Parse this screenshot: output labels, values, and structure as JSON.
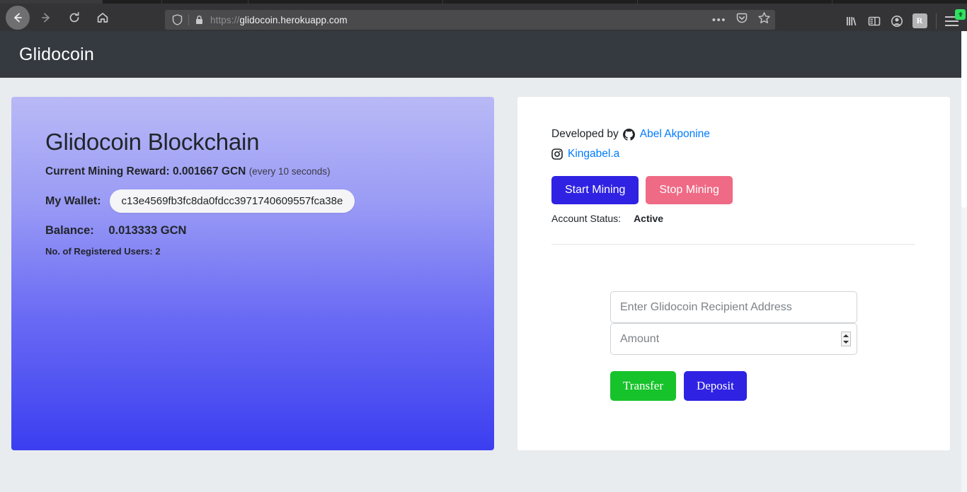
{
  "browser": {
    "url_scheme": "https://",
    "url_host": "glidocoin.herokuapp.com",
    "back_icon": "back-arrow-icon",
    "forward_icon": "forward-arrow-icon",
    "reload_icon": "reload-icon",
    "home_icon": "home-icon",
    "shield_icon": "shield-icon",
    "lock_icon": "lock-icon",
    "page_actions_icon": "ellipsis-icon",
    "pocket_icon": "pocket-icon",
    "bookmark_icon": "star-icon",
    "library_icon": "library-icon",
    "sidebar_icon": "sidebar-icon",
    "account_icon": "account-icon",
    "extension_badge_label": "R",
    "menu_icon": "hamburger-menu-icon",
    "update_badge_icon": "update-available-icon"
  },
  "site": {
    "brand": "Glidocoin",
    "navbar_color": "#343a40",
    "page_background": "#e9ecef"
  },
  "hero": {
    "title": "Glidocoin Blockchain",
    "reward_label": "Current Mining Reward: 0.001667 GCN",
    "reward_interval": "(every 10 seconds)",
    "wallet_label": "My Wallet:",
    "wallet_address": "c13e4569fb3fc8da0fdcc3971740609557fca38e",
    "balance_label": "Balance:",
    "balance_value": "0.013333 GCN",
    "registered_users": "No. of Registered Users: 2",
    "gradient_from": "#b9b9f6",
    "gradient_to": "#3b3ef0"
  },
  "panel": {
    "developed_by_text": "Developed by",
    "developer_name": "Abel Akponine",
    "github_icon": "github-icon",
    "instagram_icon": "instagram-icon",
    "instagram_handle": "Kingabel.a",
    "link_color": "#007bff",
    "start_mining_label": "Start Mining",
    "stop_mining_label": "Stop Mining",
    "start_mining_color": "#2f22e3",
    "stop_mining_color": "#ef6a85",
    "account_status_label": "Account Status:",
    "account_status_value": "Active",
    "recipient_placeholder": "Enter Glidocoin Recipient Address",
    "recipient_value": "",
    "amount_placeholder": "Amount",
    "amount_value": "",
    "transfer_label": "Transfer",
    "deposit_label": "Deposit",
    "transfer_color": "#16c32a",
    "deposit_color": "#2f22e3"
  }
}
